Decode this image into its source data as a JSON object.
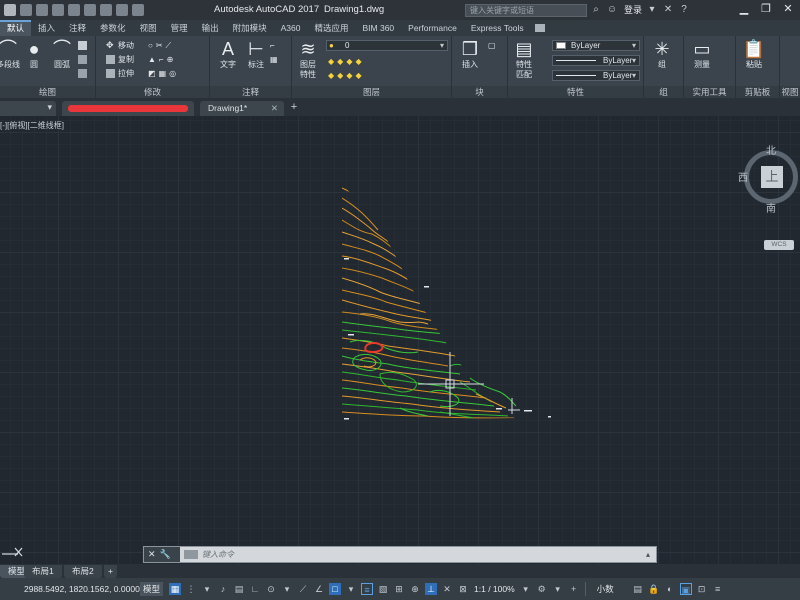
{
  "title_bar": {
    "app_name": "Autodesk AutoCAD 2017",
    "file_name": "Drawing1.dwg",
    "search_placeholder": "键入关键字或短语",
    "login_label": "登录"
  },
  "ribbon_tabs": [
    {
      "label": "默认",
      "active": true
    },
    {
      "label": "插入"
    },
    {
      "label": "注释"
    },
    {
      "label": "参数化"
    },
    {
      "label": "视图"
    },
    {
      "label": "管理"
    },
    {
      "label": "输出"
    },
    {
      "label": "附加模块"
    },
    {
      "label": "A360"
    },
    {
      "label": "精选应用"
    },
    {
      "label": "BIM 360"
    },
    {
      "label": "Performance"
    },
    {
      "label": "Express Tools"
    }
  ],
  "ribbon": {
    "draw": {
      "polyline": "多段线",
      "circle": "圆",
      "arc": "圆弧",
      "panel_label": "绘图"
    },
    "modify": {
      "move": "移动",
      "copy": "复制",
      "stretch": "拉伸",
      "panel_label": "修改"
    },
    "annotation": {
      "text": "文字",
      "dimension": "标注",
      "panel_label": "注释"
    },
    "layers": {
      "layer_properties": "图层\n特性",
      "current_layer": "0",
      "panel_label": "图层"
    },
    "block": {
      "insert": "插入",
      "panel_label": "块"
    },
    "properties": {
      "match": "特性\n匹配",
      "color": "ByLayer",
      "linetype": "ByLayer",
      "lineweight": "ByLayer",
      "panel_label": "特性"
    },
    "groups": {
      "group": "组",
      "panel_label": "组"
    },
    "utilities": {
      "measure": "测量",
      "panel_label": "实用工具"
    },
    "clipboard": {
      "paste": "粘贴",
      "panel_label": "剪贴板"
    },
    "view": {
      "panel_label": "视图"
    }
  },
  "file_tabs": {
    "active": "Drawing1*"
  },
  "viewport": {
    "label": "[-][俯视][二维线框]"
  },
  "viewcube": {
    "face": "上",
    "north": "北",
    "west": "西",
    "south": "南",
    "wcs": "WCS"
  },
  "command_line": {
    "placeholder": "键入命令"
  },
  "layout_tabs": [
    "模型",
    "布局1",
    "布局2"
  ],
  "status_bar": {
    "coordinates": "2988.5492, 1820.1562, 0.0000",
    "model": "模型",
    "annotation_scale": "1:1 / 100%",
    "units": "小数"
  },
  "colors": {
    "canvas": "#212830",
    "contour_orange": "#e39a2b",
    "contour_green": "#38c838"
  }
}
